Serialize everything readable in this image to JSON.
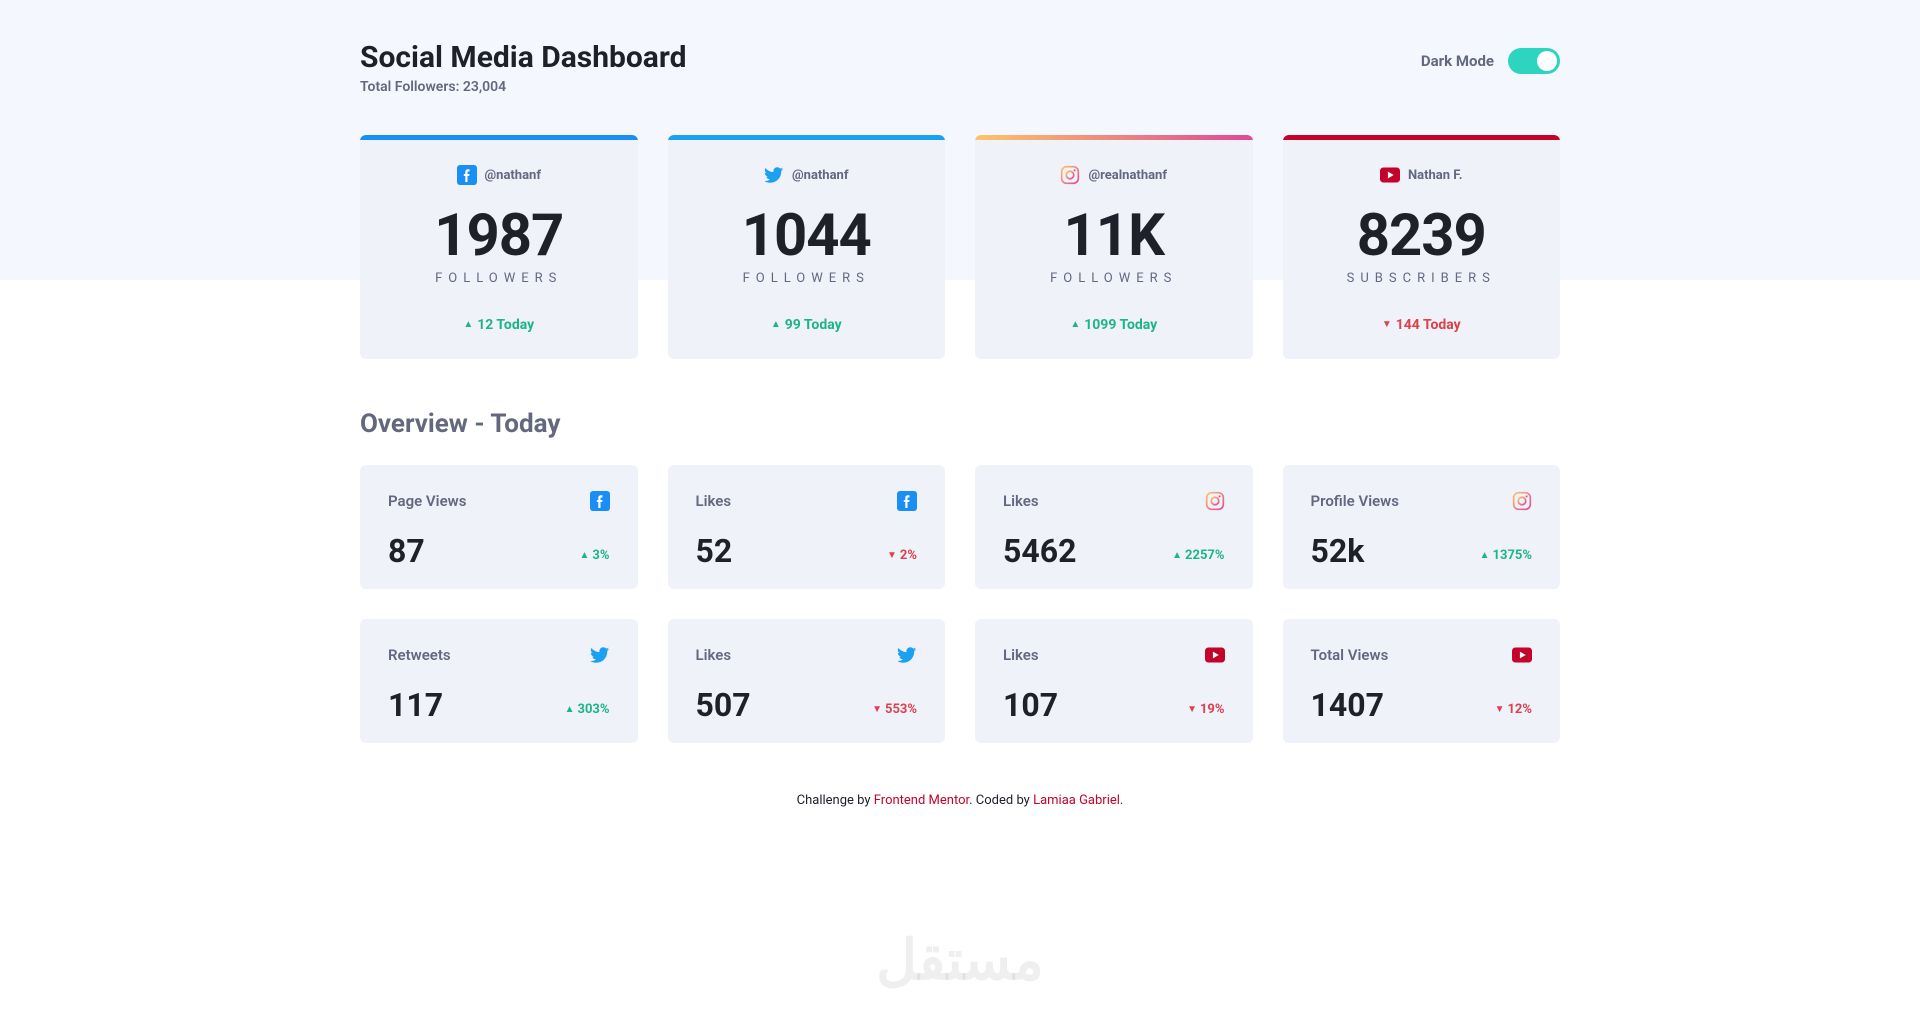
{
  "header": {
    "title": "Social Media Dashboard",
    "subtitle": "Total Followers: 23,004",
    "dark_mode_label": "Dark Mode"
  },
  "colors": {
    "facebook": "#198ff5",
    "twitter": "#1ca0f2",
    "youtube": "#c4032a",
    "up": "#1db489",
    "down": "#dc414c"
  },
  "top_cards": [
    {
      "platform": "facebook",
      "handle": "@nathanf",
      "count": "1987",
      "label": "FOLLOWERS",
      "change": "12 Today",
      "direction": "up"
    },
    {
      "platform": "twitter",
      "handle": "@nathanf",
      "count": "1044",
      "label": "FOLLOWERS",
      "change": "99 Today",
      "direction": "up"
    },
    {
      "platform": "instagram",
      "handle": "@realnathanf",
      "count": "11K",
      "label": "FOLLOWERS",
      "change": "1099 Today",
      "direction": "up"
    },
    {
      "platform": "youtube",
      "handle": "Nathan F.",
      "count": "8239",
      "label": "SUBSCRIBERS",
      "change": "144 Today",
      "direction": "down"
    }
  ],
  "overview": {
    "title": "Overview - Today",
    "cards": [
      {
        "label": "Page Views",
        "platform": "facebook",
        "value": "87",
        "change": "3%",
        "direction": "up"
      },
      {
        "label": "Likes",
        "platform": "facebook",
        "value": "52",
        "change": "2%",
        "direction": "down"
      },
      {
        "label": "Likes",
        "platform": "instagram",
        "value": "5462",
        "change": "2257%",
        "direction": "up"
      },
      {
        "label": "Profile Views",
        "platform": "instagram",
        "value": "52k",
        "change": "1375%",
        "direction": "up"
      },
      {
        "label": "Retweets",
        "platform": "twitter",
        "value": "117",
        "change": "303%",
        "direction": "up"
      },
      {
        "label": "Likes",
        "platform": "twitter",
        "value": "507",
        "change": "553%",
        "direction": "down"
      },
      {
        "label": "Likes",
        "platform": "youtube",
        "value": "107",
        "change": "19%",
        "direction": "down"
      },
      {
        "label": "Total Views",
        "platform": "youtube",
        "value": "1407",
        "change": "12%",
        "direction": "down"
      }
    ]
  },
  "footer": {
    "prefix": "Challenge by ",
    "link1": "Frontend Mentor",
    "mid": ". Coded by ",
    "link2": "Lamiaa Gabriel",
    "suffix": "."
  },
  "watermark": "مستقل"
}
